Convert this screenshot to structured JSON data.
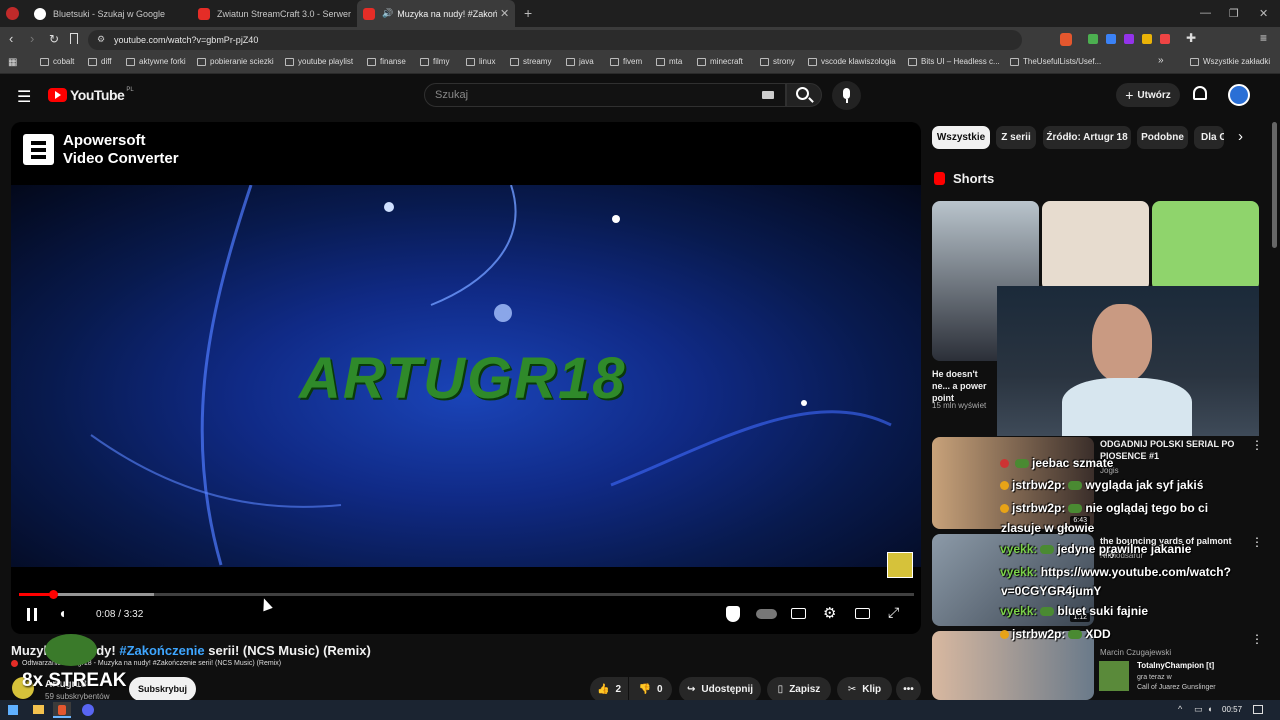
{
  "browser": {
    "tabs": [
      {
        "title": "Bluetsuki - Szukaj w Google",
        "active": false
      },
      {
        "title": "Zwiatun StreamCraft 3.0 - Serwer dla",
        "active": false
      },
      {
        "title": "Muzyka na nudy! #Zakończe",
        "active": true
      }
    ],
    "url": "youtube.com/watch?v=gbmPr-pjZ40",
    "bookmarks": [
      "cobalt",
      "diff",
      "aktywne forki",
      "pobieranie sciezki",
      "youtube playlist",
      "finanse",
      "filmy",
      "linux",
      "streamy",
      "java",
      "fivem",
      "mta",
      "minecraft",
      "strony",
      "vscode klawiszologia",
      "Bits UI – Headless c...",
      "TheUsefulLists/Usef...",
      "Wszystkie zakładki"
    ]
  },
  "youtube": {
    "logo_text": "YouTube",
    "logo_region": "PL",
    "search_placeholder": "Szukaj",
    "create_label": "Utwórz"
  },
  "player": {
    "watermark_line1": "Apowersoft",
    "watermark_line2": "Video Converter",
    "video_text": "ARTUGR18",
    "time": "0:08 / 3:32",
    "progress_fraction": 0.038
  },
  "video": {
    "title_prefix": "Muzyka na nudy! ",
    "title_hashtag": "#Zakończenie",
    "title_suffix": " serii! (NCS Music) (Remix)",
    "playing_line": "Odtwarzanie: Artugr18 - Muzyka na nudy! #Zakończenie serii! (NCS Music) (Remix)",
    "channel": "Artugr18",
    "subscribers": "59 subskrybentów",
    "subscribe_label": "Subskrybuj",
    "likes": "2",
    "dislikes": "0",
    "share_label": "Udostępnij",
    "save_label": "Zapisz",
    "clip_label": "Klip"
  },
  "sidebar": {
    "chips": [
      "Wszystkie",
      "Z serii",
      "Źródło: Artugr 18",
      "Podobne",
      "Dla C"
    ],
    "shorts_heading": "Shorts",
    "shorts": [
      {
        "title": "He doesn't ne... a power point",
        "views": "15 mln wyświet"
      }
    ],
    "recommended": [
      {
        "title": "ODGADNIJ POLSKI SERIAL PO PIOSENCE #1",
        "channel": "Jogis",
        "duration": "6:43"
      },
      {
        "title": "the bouncing yards of palmont city",
        "channel": "Nilmodsarur",
        "duration": "1:12"
      },
      {
        "title": "",
        "channel": "Marcin Czugajewski",
        "duration": ""
      }
    ]
  },
  "overlay": {
    "chat": [
      {
        "user": "",
        "text": "jeebac szmate"
      },
      {
        "user": "jstrbw2p:",
        "text": "wygląda jak syf jakiś"
      },
      {
        "user": "jstrbw2p:",
        "text": "nie oglądaj tego bo ci"
      },
      {
        "user": "",
        "text": "zlasuje w głowie"
      },
      {
        "user": "vyekk:",
        "text": "jedyne prawilne jakanie"
      },
      {
        "user": "vyekk:",
        "text": "https://www.youtube.com/watch?"
      },
      {
        "user": "",
        "text": "v=0CGYGR4jumY"
      },
      {
        "user": "vyekk:",
        "text": "bluet suki fajnie"
      },
      {
        "user": "jstrbw2p:",
        "text": "XDD"
      }
    ],
    "streak": "8x STREAK",
    "notification": {
      "name": "TotalnyChampion [t]",
      "status": "gra teraz w",
      "game": "Call of Juarez Gunslinger"
    }
  },
  "taskbar": {
    "time": "00:57"
  }
}
